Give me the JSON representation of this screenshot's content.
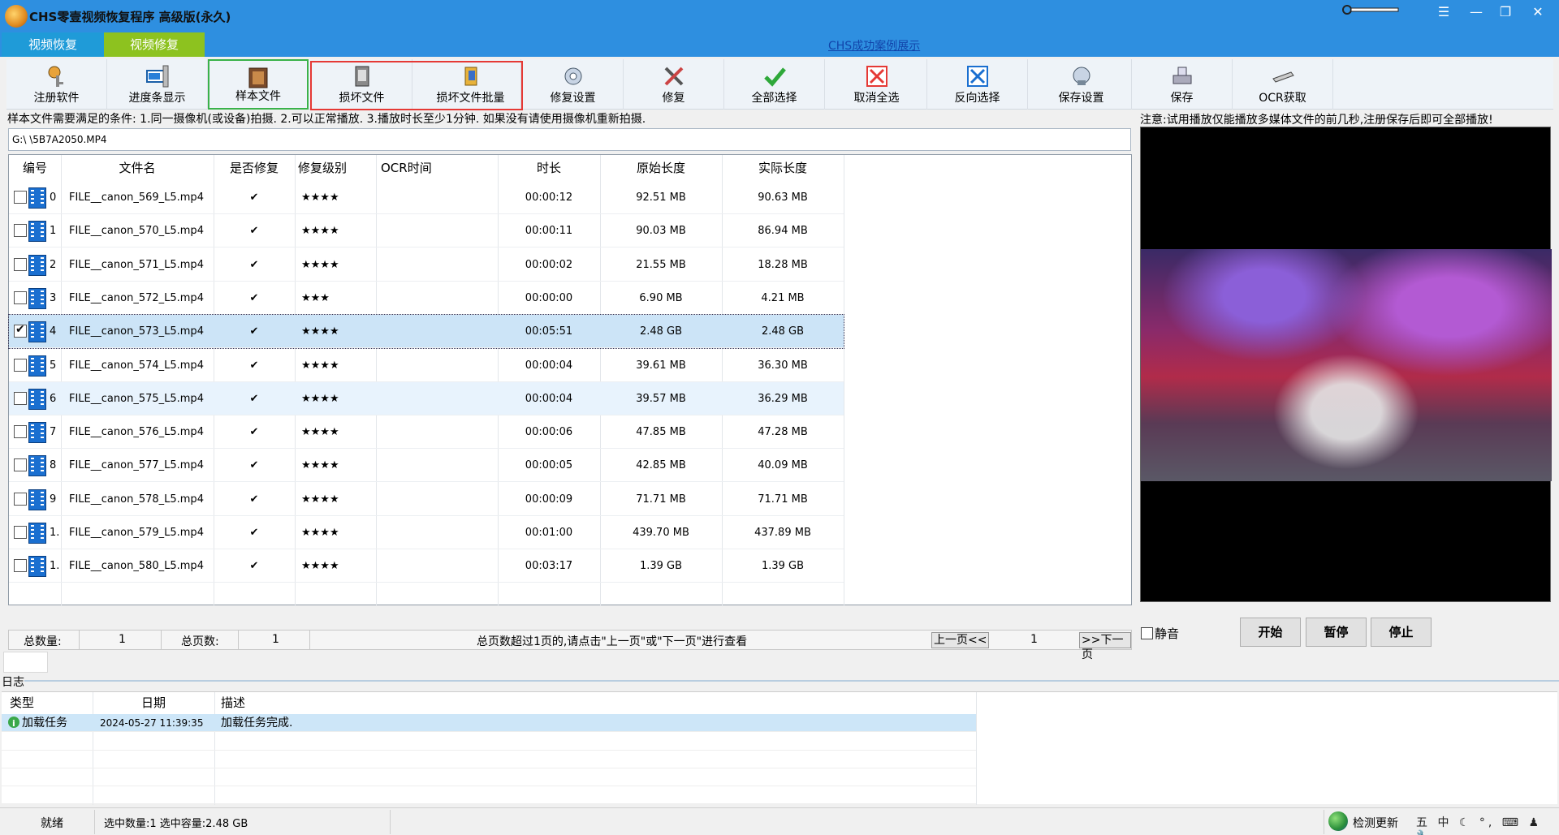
{
  "window": {
    "title": "CHS零壹视频恢复程序 高级版(永久)",
    "controls": {
      "menu": "☰",
      "minimize": "—",
      "restore": "❐",
      "close": "✕"
    }
  },
  "tabs": [
    {
      "label": "视频恢复"
    },
    {
      "label": "视频修复"
    }
  ],
  "showcase_link": "CHS成功案例展示",
  "toolbar": [
    {
      "label": "注册软件",
      "icon": "key-person-icon"
    },
    {
      "label": "进度条显示",
      "icon": "progress-display-icon"
    },
    {
      "label": "样本文件",
      "icon": "sample-film-icon"
    },
    {
      "label": "损坏文件",
      "icon": "damaged-file-icon"
    },
    {
      "label": "损坏文件批量",
      "icon": "damaged-batch-icon"
    },
    {
      "label": "修复设置",
      "icon": "repair-settings-icon"
    },
    {
      "label": "修复",
      "icon": "tools-icon"
    },
    {
      "label": "全部选择",
      "icon": "check-icon"
    },
    {
      "label": "取消全选",
      "icon": "cancel-select-icon"
    },
    {
      "label": "反向选择",
      "icon": "invert-select-icon"
    },
    {
      "label": "保存设置",
      "icon": "save-settings-icon"
    },
    {
      "label": "保存",
      "icon": "save-drive-icon"
    },
    {
      "label": "OCR获取",
      "icon": "ocr-scanner-icon"
    }
  ],
  "requirement_note": "样本文件需要满足的条件: 1.同一摄像机(或设备)拍摄. 2.可以正常播放. 3.播放时长至少1分钟.  如果没有请使用摄像机重新拍摄.",
  "path": "G:\\                                              \\5B7A2050.MP4",
  "file_table": {
    "columns": [
      "编号",
      "文件名",
      "是否修复",
      "修复级别",
      "OCR时间",
      "时长",
      "原始长度",
      "实际长度"
    ],
    "rows": [
      {
        "num": "0",
        "name": "FILE__canon_569_L5.mp4",
        "repaired": "✔",
        "level": "★★★★",
        "ocr": "",
        "duration": "00:00:12",
        "orig": "92.51 MB",
        "actual": "90.63 MB",
        "checked": false
      },
      {
        "num": "1",
        "name": "FILE__canon_570_L5.mp4",
        "repaired": "✔",
        "level": "★★★★",
        "ocr": "",
        "duration": "00:00:11",
        "orig": "90.03 MB",
        "actual": "86.94 MB",
        "checked": false
      },
      {
        "num": "2",
        "name": "FILE__canon_571_L5.mp4",
        "repaired": "✔",
        "level": "★★★★",
        "ocr": "",
        "duration": "00:00:02",
        "orig": "21.55 MB",
        "actual": "18.28 MB",
        "checked": false
      },
      {
        "num": "3",
        "name": "FILE__canon_572_L5.mp4",
        "repaired": "✔",
        "level": "★★★",
        "ocr": "",
        "duration": "00:00:00",
        "orig": "6.90 MB",
        "actual": "4.21 MB",
        "checked": false
      },
      {
        "num": "4",
        "name": "FILE__canon_573_L5.mp4",
        "repaired": "✔",
        "level": "★★★★",
        "ocr": "",
        "duration": "00:05:51",
        "orig": "2.48 GB",
        "actual": "2.48 GB",
        "checked": true
      },
      {
        "num": "5",
        "name": "FILE__canon_574_L5.mp4",
        "repaired": "✔",
        "level": "★★★★",
        "ocr": "",
        "duration": "00:00:04",
        "orig": "39.61 MB",
        "actual": "36.30 MB",
        "checked": false
      },
      {
        "num": "6",
        "name": "FILE__canon_575_L5.mp4",
        "repaired": "✔",
        "level": "★★★★",
        "ocr": "",
        "duration": "00:00:04",
        "orig": "39.57 MB",
        "actual": "36.29 MB",
        "checked": false
      },
      {
        "num": "7",
        "name": "FILE__canon_576_L5.mp4",
        "repaired": "✔",
        "level": "★★★★",
        "ocr": "",
        "duration": "00:00:06",
        "orig": "47.85 MB",
        "actual": "47.28 MB",
        "checked": false
      },
      {
        "num": "8",
        "name": "FILE__canon_577_L5.mp4",
        "repaired": "✔",
        "level": "★★★★",
        "ocr": "",
        "duration": "00:00:05",
        "orig": "42.85 MB",
        "actual": "40.09 MB",
        "checked": false
      },
      {
        "num": "9",
        "name": "FILE__canon_578_L5.mp4",
        "repaired": "✔",
        "level": "★★★★",
        "ocr": "",
        "duration": "00:00:09",
        "orig": "71.71 MB",
        "actual": "71.71 MB",
        "checked": false
      },
      {
        "num": "1.",
        "name": "FILE__canon_579_L5.mp4",
        "repaired": "✔",
        "level": "★★★★",
        "ocr": "",
        "duration": "00:01:00",
        "orig": "439.70 MB",
        "actual": "437.89 MB",
        "checked": false
      },
      {
        "num": "1.",
        "name": "FILE__canon_580_L5.mp4",
        "repaired": "✔",
        "level": "★★★★",
        "ocr": "",
        "duration": "00:03:17",
        "orig": "1.39 GB",
        "actual": "1.39 GB",
        "checked": false
      }
    ]
  },
  "preview": {
    "note": "注意:试用播放仅能播放多媒体文件的前几秒,注册保存后即可全部播放!",
    "mute_label": "静音",
    "buttons": [
      "开始",
      "暂停",
      "停止"
    ]
  },
  "pager": {
    "total_count_label": "总数量:",
    "total_count": "1",
    "total_pages_label": "总页数:",
    "total_pages": "1",
    "hint": "总页数超过1页的,请点击\"上一页\"或\"下一页\"进行查看",
    "prev": "上一页<<",
    "current": "1",
    "next": ">>下一页"
  },
  "log": {
    "title": "日志",
    "columns": [
      "类型",
      "日期",
      "描述"
    ],
    "rows": [
      {
        "type": "加载任务",
        "date": "2024-05-27 11:39:35",
        "desc": "加载任务完成."
      }
    ]
  },
  "statusbar": {
    "ready": "就绪",
    "selection": "选中数量:1 选中容量:2.48 GB",
    "update": "检测更新",
    "ime": "五 中 ☾ °, ⌨ ♟ 🔧"
  }
}
